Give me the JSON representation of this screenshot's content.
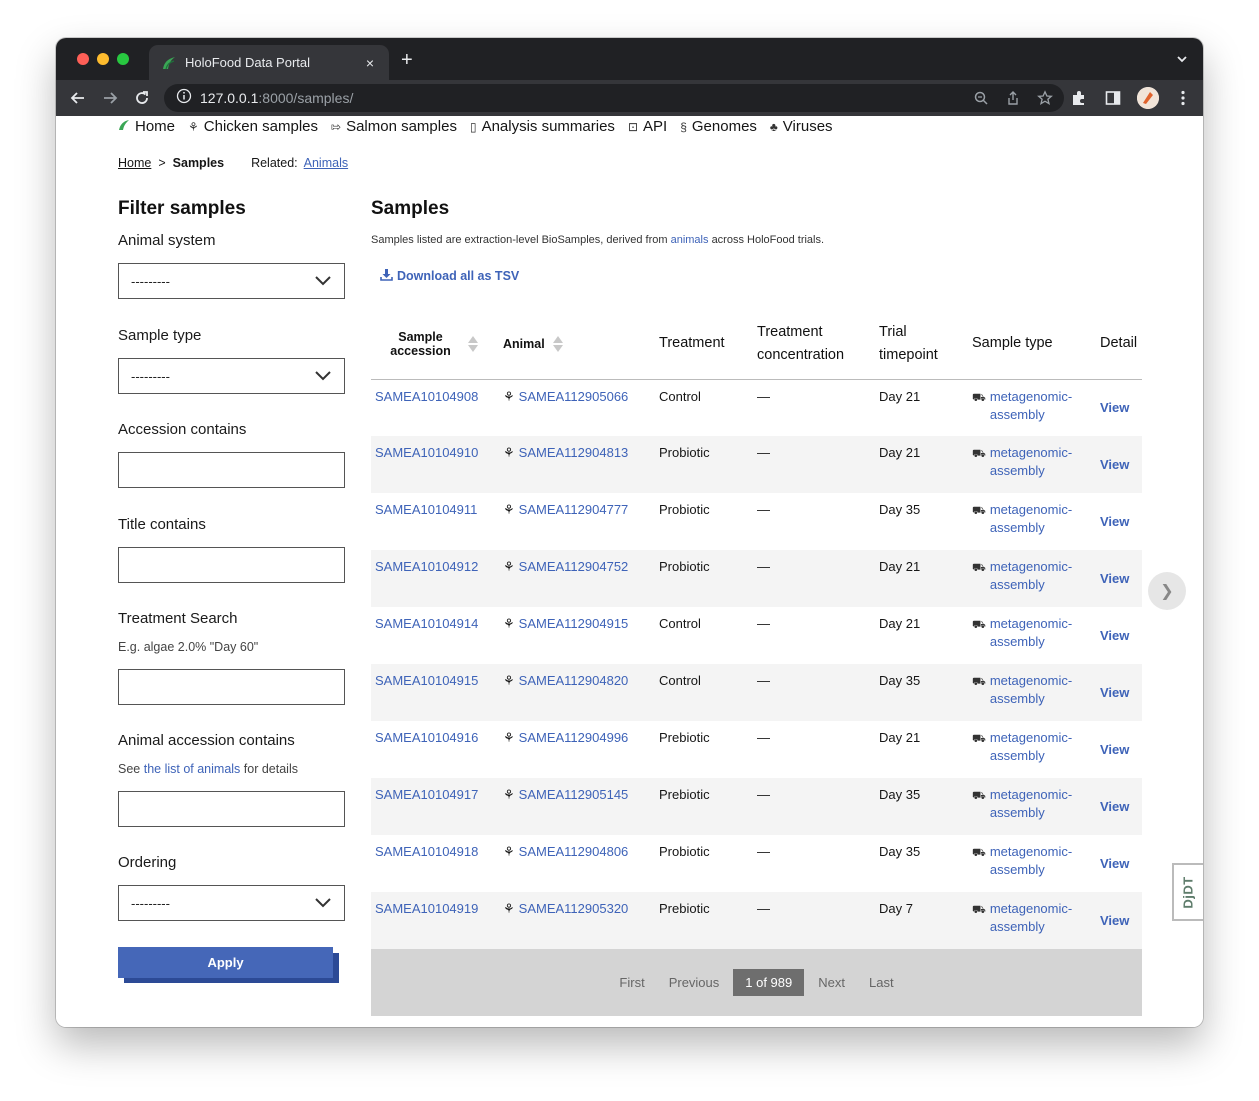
{
  "browser": {
    "tab_title": "HoloFood Data Portal",
    "tab_close": "×",
    "new_tab": "+",
    "url_host": "127.0.0.1",
    "url_path": ":8000/samples/"
  },
  "nav": {
    "items": [
      {
        "label": "Home",
        "icon": "holofood-logo-icon"
      },
      {
        "label": "Chicken samples",
        "icon": "chicken-icon"
      },
      {
        "label": "Salmon samples",
        "icon": "fish-icon"
      },
      {
        "label": "Analysis summaries",
        "icon": "document-icon"
      },
      {
        "label": "API",
        "icon": "api-icon"
      },
      {
        "label": "Genomes",
        "icon": "genome-icon"
      },
      {
        "label": "Viruses",
        "icon": "virus-icon"
      }
    ]
  },
  "breadcrumb": {
    "home": "Home",
    "separator": ">",
    "current": "Samples",
    "related_label": "Related:",
    "related_link": "Animals"
  },
  "filters": {
    "title": "Filter samples",
    "animal_system_label": "Animal system",
    "animal_system_value": "---------",
    "sample_type_label": "Sample type",
    "sample_type_value": "---------",
    "accession_label": "Accession contains",
    "title_label": "Title contains",
    "treatment_label": "Treatment Search",
    "treatment_help": "E.g. algae 2.0% \"Day 60\"",
    "animal_accession_label": "Animal accession contains",
    "animal_accession_help_pre": "See",
    "animal_accession_help_link": "the list of animals",
    "animal_accession_help_post": "for details",
    "ordering_label": "Ordering",
    "ordering_value": "---------",
    "apply_label": "Apply"
  },
  "main": {
    "title": "Samples",
    "intro_pre": "Samples listed are extraction-level BioSamples, derived from",
    "intro_link": "animals",
    "intro_post": "across HoloFood trials.",
    "download_label": "Download all as TSV"
  },
  "table": {
    "headers": {
      "accession": "Sample accession",
      "animal": "Animal",
      "treatment": "Treatment",
      "concentration": "Treatment concentration",
      "timepoint": "Trial timepoint",
      "sample_type": "Sample type",
      "detail": "Detail"
    },
    "rows": [
      {
        "accession": "SAMEA10104908",
        "animal": "SAMEA112905066",
        "treatment": "Control",
        "concentration": "—",
        "timepoint": "Day 21",
        "type_line1": "metagenomic-",
        "type_line2": "assembly",
        "detail": "View"
      },
      {
        "accession": "SAMEA10104910",
        "animal": "SAMEA112904813",
        "treatment": "Probiotic",
        "concentration": "—",
        "timepoint": "Day 21",
        "type_line1": "metagenomic-",
        "type_line2": "assembly",
        "detail": "View"
      },
      {
        "accession": "SAMEA10104911",
        "animal": "SAMEA112904777",
        "treatment": "Probiotic",
        "concentration": "—",
        "timepoint": "Day 35",
        "type_line1": "metagenomic-",
        "type_line2": "assembly",
        "detail": "View"
      },
      {
        "accession": "SAMEA10104912",
        "animal": "SAMEA112904752",
        "treatment": "Probiotic",
        "concentration": "—",
        "timepoint": "Day 21",
        "type_line1": "metagenomic-",
        "type_line2": "assembly",
        "detail": "View"
      },
      {
        "accession": "SAMEA10104914",
        "animal": "SAMEA112904915",
        "treatment": "Control",
        "concentration": "—",
        "timepoint": "Day 21",
        "type_line1": "metagenomic-",
        "type_line2": "assembly",
        "detail": "View"
      },
      {
        "accession": "SAMEA10104915",
        "animal": "SAMEA112904820",
        "treatment": "Control",
        "concentration": "—",
        "timepoint": "Day 35",
        "type_line1": "metagenomic-",
        "type_line2": "assembly",
        "detail": "View"
      },
      {
        "accession": "SAMEA10104916",
        "animal": "SAMEA112904996",
        "treatment": "Prebiotic",
        "concentration": "—",
        "timepoint": "Day 21",
        "type_line1": "metagenomic-",
        "type_line2": "assembly",
        "detail": "View"
      },
      {
        "accession": "SAMEA10104917",
        "animal": "SAMEA112905145",
        "treatment": "Prebiotic",
        "concentration": "—",
        "timepoint": "Day 35",
        "type_line1": "metagenomic-",
        "type_line2": "assembly",
        "detail": "View"
      },
      {
        "accession": "SAMEA10104918",
        "animal": "SAMEA112904806",
        "treatment": "Probiotic",
        "concentration": "—",
        "timepoint": "Day 35",
        "type_line1": "metagenomic-",
        "type_line2": "assembly",
        "detail": "View"
      },
      {
        "accession": "SAMEA10104919",
        "animal": "SAMEA112905320",
        "treatment": "Prebiotic",
        "concentration": "—",
        "timepoint": "Day 7",
        "type_line1": "metagenomic-",
        "type_line2": "assembly",
        "detail": "View"
      }
    ]
  },
  "pagination": {
    "first": "First",
    "previous": "Previous",
    "current": "1 of 989",
    "next": "Next",
    "last": "Last"
  },
  "widgets": {
    "carousel_next": "❯",
    "djdt_label": "DjDT"
  },
  "colors": {
    "link": "#3e63b8",
    "apply_button": "#4567b8",
    "row_shade": "#f4f4f4",
    "pager_bg": "#d4d4d4"
  }
}
